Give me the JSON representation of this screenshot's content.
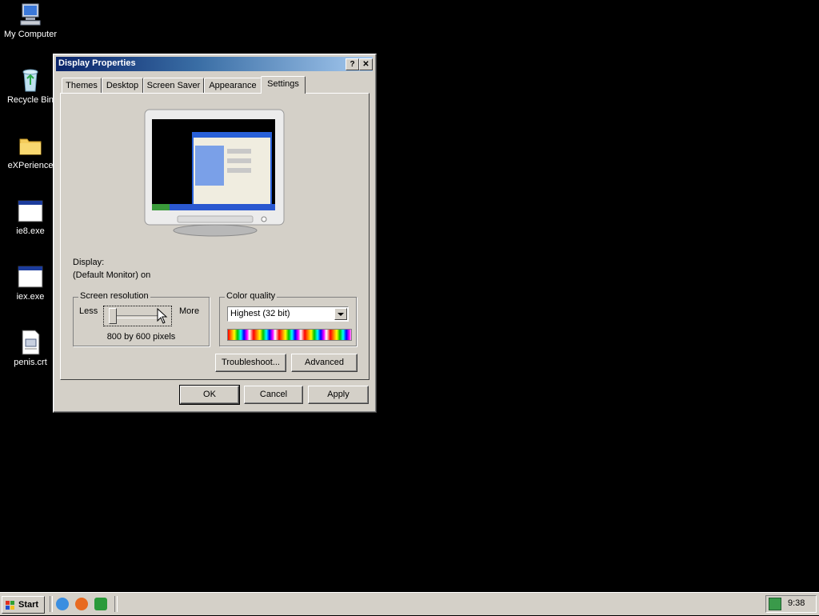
{
  "desktop": {
    "icons": [
      {
        "label": "My Computer",
        "icon": "computer-icon"
      },
      {
        "label": "Recycle Bin",
        "icon": "recycle-bin-icon"
      },
      {
        "label": "eXPerience",
        "icon": "folder-icon"
      },
      {
        "label": "ie8.exe",
        "icon": "window-icon"
      },
      {
        "label": "iex.exe",
        "icon": "window-icon"
      },
      {
        "label": "penis.crt",
        "icon": "certificate-icon"
      }
    ]
  },
  "window": {
    "title": "Display Properties",
    "help_button": "?",
    "close_button": "✕",
    "tabs": [
      {
        "label": "Themes",
        "active": false
      },
      {
        "label": "Desktop",
        "active": false
      },
      {
        "label": "Screen Saver",
        "active": false
      },
      {
        "label": "Appearance",
        "active": false
      },
      {
        "label": "Settings",
        "active": true
      }
    ],
    "display_label": "Display:",
    "display_value": "(Default Monitor) on",
    "resolution": {
      "group_label": "Screen resolution",
      "less_label": "Less",
      "more_label": "More",
      "value_text": "800 by 600 pixels",
      "slider_fraction": 0.0
    },
    "color_quality": {
      "group_label": "Color quality",
      "selected": "Highest (32 bit)"
    },
    "buttons": {
      "troubleshoot": "Troubleshoot...",
      "advanced": "Advanced",
      "ok": "OK",
      "cancel": "Cancel",
      "apply": "Apply"
    }
  },
  "taskbar": {
    "start_label": "Start",
    "clock": "9:38"
  },
  "colors": {
    "desktop_bg": "#000000",
    "dialog_face": "#d4d0c8",
    "title_start": "#0a246a",
    "title_end": "#a6caf0"
  }
}
